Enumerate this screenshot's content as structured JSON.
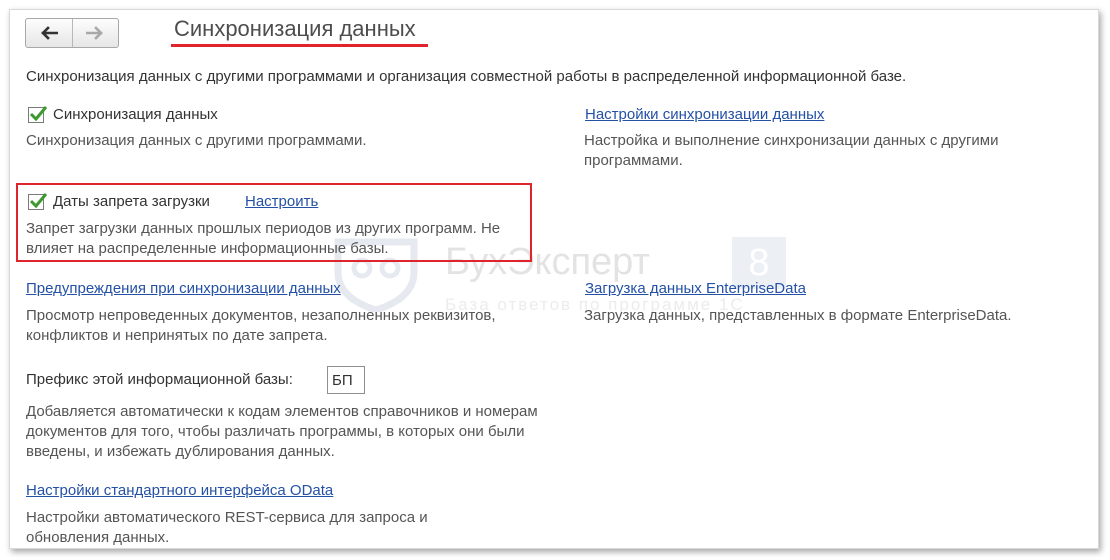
{
  "toolbar": {
    "back_icon": "arrow-left-icon",
    "forward_icon": "arrow-right-icon"
  },
  "page": {
    "title": "Синхронизация данных",
    "intro": "Синхронизация данных с другими программами и организация совместной работы в распределенной информационной базе."
  },
  "sync_data": {
    "checked": true,
    "label": "Синхронизация данных",
    "desc": "Синхронизация данных с другими программами."
  },
  "sync_settings": {
    "link": "Настройки синхронизации данных",
    "desc": "Настройка и выполнение синхронизации данных с другими программами."
  },
  "load_ban": {
    "checked": true,
    "label": "Даты запрета загрузки",
    "link": "Настроить",
    "desc": "Запрет загрузки данных прошлых периодов из других программ. Не влияет на распределенные информационные базы."
  },
  "sync_warnings": {
    "link": "Предупреждения при синхронизации данных",
    "desc": "Просмотр непроведенных документов, незаполненных реквизитов, конфликтов и непринятых по дате запрета."
  },
  "enterprise_data": {
    "link": "Загрузка данных EnterpriseData",
    "desc": "Загрузка данных, представленных в формате EnterpriseData."
  },
  "prefix": {
    "label": "Префикс этой информационной базы:",
    "value": "БП",
    "desc": "Добавляется автоматически к кодам элементов справочников и номерам документов для того, чтобы различать программы, в которых они были введены, и избежать дублирования данных."
  },
  "odata": {
    "link": "Настройки стандартного интерфейса OData",
    "desc": "Настройки автоматического REST-сервиса для запроса и обновления данных."
  },
  "watermark": {
    "brand": "БухЭксперт",
    "badge": "8",
    "tagline": "База ответов по программе 1С"
  },
  "colors": {
    "accent_red": "#e0242e",
    "link_blue": "#2451a6",
    "check_green": "#3c9a2e"
  }
}
